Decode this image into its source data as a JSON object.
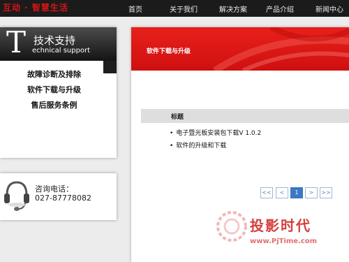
{
  "header": {
    "slogan": "互动 · 智慧生活",
    "nav": [
      "首页",
      "关于我们",
      "解决方案",
      "产品介绍",
      "新闻中心"
    ]
  },
  "sidebar": {
    "big_letter": "T",
    "title": "技术支持",
    "subtitle": "echnical support",
    "menu": [
      "故障诊断及排除",
      "软件下载与升级",
      "售后服务条例"
    ],
    "contact_label": "咨询电话：",
    "contact_phone": "027-87778082"
  },
  "main": {
    "title": "软件下载与升级",
    "column_header": "标题",
    "items": [
      "电子暨光板安装包下载V 1.0.2",
      "软件的升级和下载"
    ],
    "pagination": {
      "first": "<<",
      "prev": "<",
      "current": "1",
      "next": ">",
      "last": ">>"
    }
  },
  "watermark": {
    "title": "投影时代",
    "url": "www.PjTime.com"
  },
  "colors": {
    "accent_red": "#d81414",
    "pager_active": "#3b78c4"
  }
}
